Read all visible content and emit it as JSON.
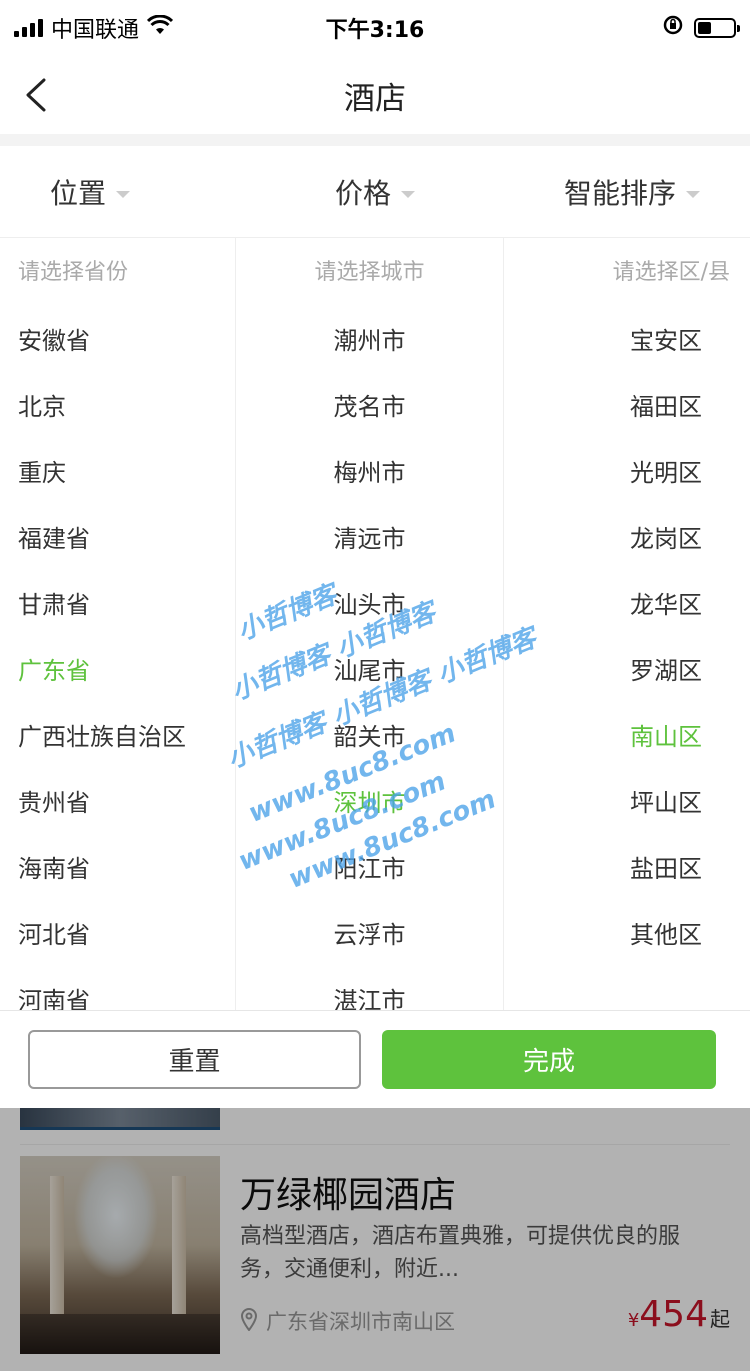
{
  "status_bar": {
    "carrier": "中国联通",
    "time": "下午3:16"
  },
  "nav": {
    "title": "酒店"
  },
  "filters": [
    "位置",
    "价格",
    "智能排序"
  ],
  "picker": {
    "province_placeholder": "请选择省份",
    "city_placeholder": "请选择城市",
    "district_placeholder": "请选择区/县",
    "provinces": [
      "安徽省",
      "北京",
      "重庆",
      "福建省",
      "甘肃省",
      "广东省",
      "广西壮族自治区",
      "贵州省",
      "海南省",
      "河北省",
      "河南省"
    ],
    "cities": [
      "潮州市",
      "茂名市",
      "梅州市",
      "清远市",
      "汕头市",
      "汕尾市",
      "韶关市",
      "深圳市",
      "阳江市",
      "云浮市",
      "湛江市"
    ],
    "districts": [
      "宝安区",
      "福田区",
      "光明区",
      "龙岗区",
      "龙华区",
      "罗湖区",
      "南山区",
      "坪山区",
      "盐田区",
      "其他区"
    ],
    "selected_province": "广东省",
    "selected_city": "深圳市",
    "selected_district": "南山区"
  },
  "buttons": {
    "reset": "重置",
    "done": "完成"
  },
  "hotel": {
    "name": "万绿椰园酒店",
    "description": "高档型酒店，酒店布置典雅，可提供优良的服务，交通便利，附近...",
    "location": "广东省深圳市南山区",
    "price_symbol": "¥",
    "price": "454",
    "price_suffix": "起"
  },
  "watermark": [
    "小哲博客",
    "小哲博客 小哲博客",
    "小哲博客 小哲博客 小哲博客",
    "www.8uc8.com"
  ],
  "colors": {
    "accent_green": "#5ec23d",
    "price_red": "#c8152a",
    "watermark_blue": "#4aa2e8"
  }
}
